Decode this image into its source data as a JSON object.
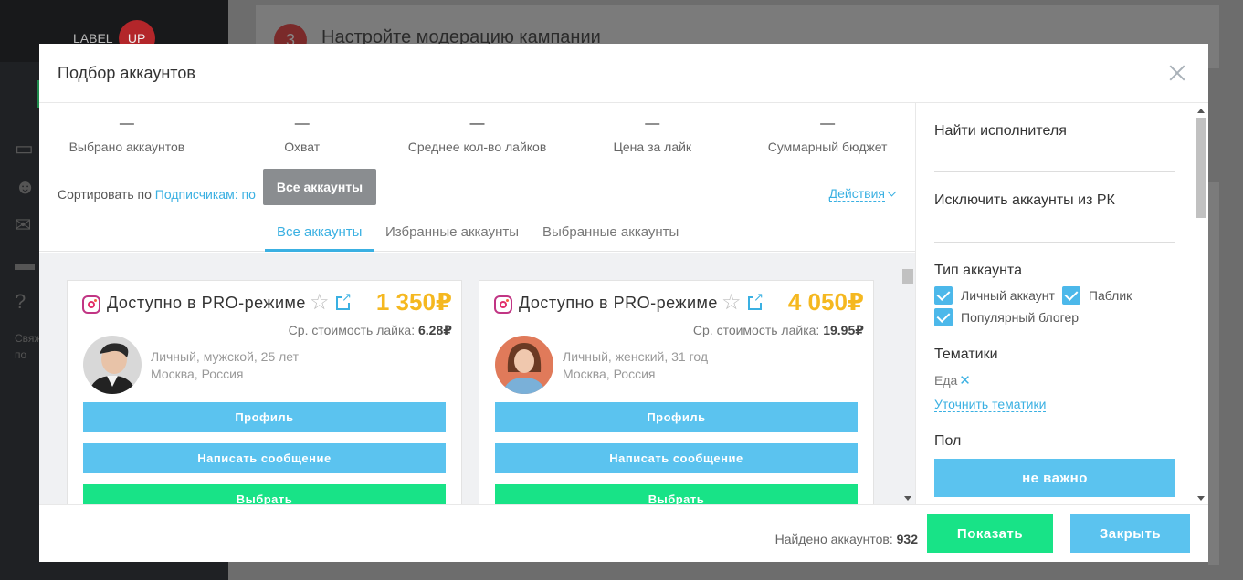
{
  "background": {
    "logo_label": "LABEL",
    "logo_badge": "UP",
    "step_number": "3",
    "step_title": "Настройте модерацию кампании",
    "sidebar_text_1": "Свяж",
    "sidebar_text_2": "по"
  },
  "modal": {
    "title": "Подбор аккаунтов",
    "stats": [
      {
        "value": "—",
        "label": "Выбрано аккаунтов"
      },
      {
        "value": "—",
        "label": "Охват"
      },
      {
        "value": "—",
        "label": "Среднее кол-во лайков"
      },
      {
        "value": "—",
        "label": "Цена за лайк"
      },
      {
        "value": "—",
        "label": "Суммарный бюджет"
      }
    ],
    "sort": {
      "label": "Сортировать по",
      "value": "Подписчикам: по",
      "tooltip": "Все аккаунты",
      "actions_label": "Действия"
    },
    "tabs": [
      {
        "label": "Все аккаунты",
        "active": true
      },
      {
        "label": "Избранные аккаунты",
        "active": false
      },
      {
        "label": "Выбранные аккаунты",
        "active": false
      }
    ],
    "cards": [
      {
        "name": "Доступно в PRO-режиме",
        "price": "1 350₽",
        "avg_label": "Ср. стоимость лайка:",
        "avg_value": "6.28₽",
        "desc_line1": "Личный, мужской, 25 лет",
        "desc_line2": "Москва, Россия",
        "profile_btn": "Профиль",
        "message_btn": "Написать сообщение",
        "select_btn": "Выбрать",
        "avatar_color": "#2b3a4a"
      },
      {
        "name": "Доступно в PRO-режиме",
        "price": "4 050₽",
        "avg_label": "Ср. стоимость лайка:",
        "avg_value": "19.95₽",
        "desc_line1": "Личный, женский, 31 год",
        "desc_line2": "Москва, Россия",
        "profile_btn": "Профиль",
        "message_btn": "Написать сообщение",
        "select_btn": "Выбрать",
        "avatar_color": "#e07a5a"
      }
    ],
    "filters": {
      "find_performer": "Найти исполнителя",
      "exclude_accounts": "Исключить аккаунты из РК",
      "account_type_title": "Тип аккаунта",
      "account_types": [
        "Личный аккаунт",
        "Паблик",
        "Популярный блогер"
      ],
      "topics_title": "Тематики",
      "topic_tag": "Еда",
      "refine_topics": "Уточнить тематики",
      "gender_title": "Пол",
      "gender_value": "не важно"
    },
    "footer": {
      "found_label": "Найдено аккаунтов:",
      "found_count": "932",
      "show_btn": "Показать",
      "close_btn": "Закрыть"
    }
  },
  "colors": {
    "accent_blue": "#5bc3ef",
    "link_blue": "#3ab0e2",
    "accent_green": "#18e387",
    "price_yellow": "#f5b820"
  }
}
